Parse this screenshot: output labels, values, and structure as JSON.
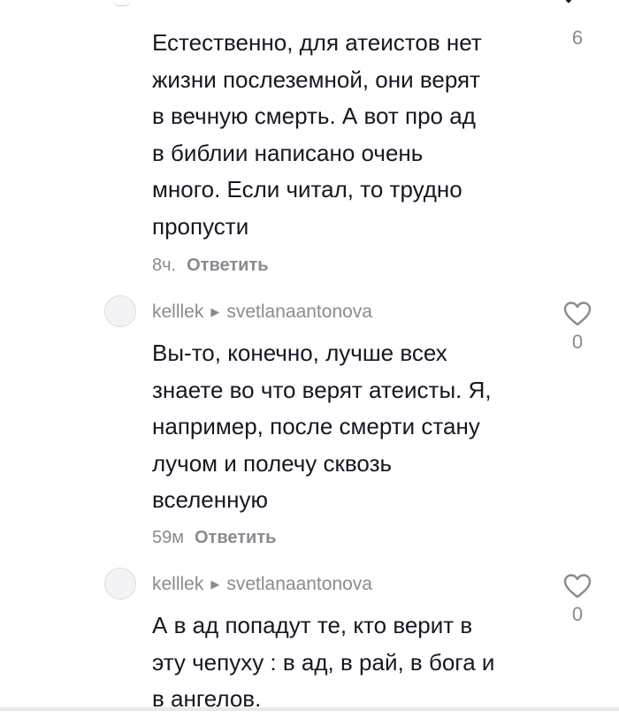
{
  "comments": [
    {
      "username": "",
      "reply_to": "",
      "text_lines": [
        "Естественно, для атеистов нет",
        "жизни послеземной, они верят",
        "в вечную смерть. А вот про ад",
        "в библии написано очень",
        "много. Если читал, то трудно",
        "пропусти"
      ],
      "time": "8ч.",
      "reply_label": "Ответить",
      "like_count": "6"
    },
    {
      "username": "kelllek",
      "reply_to": "svetlanaantonova",
      "text_lines": [
        "Вы-то, конечно, лучше всех",
        "знаете во что верят атеисты. Я,",
        "например, после смерти стану",
        "лучом и полечу сквозь",
        "вселенную"
      ],
      "time": "59м",
      "reply_label": "Ответить",
      "like_count": "0"
    },
    {
      "username": "kelllek",
      "reply_to": "svetlanaantonova",
      "text_lines": [
        "А в ад попадут те, кто верит в",
        "эту чепуху : в ад, в рай, в бога и",
        "в ангелов."
      ],
      "time": "",
      "reply_label": "",
      "like_count": "0"
    }
  ]
}
